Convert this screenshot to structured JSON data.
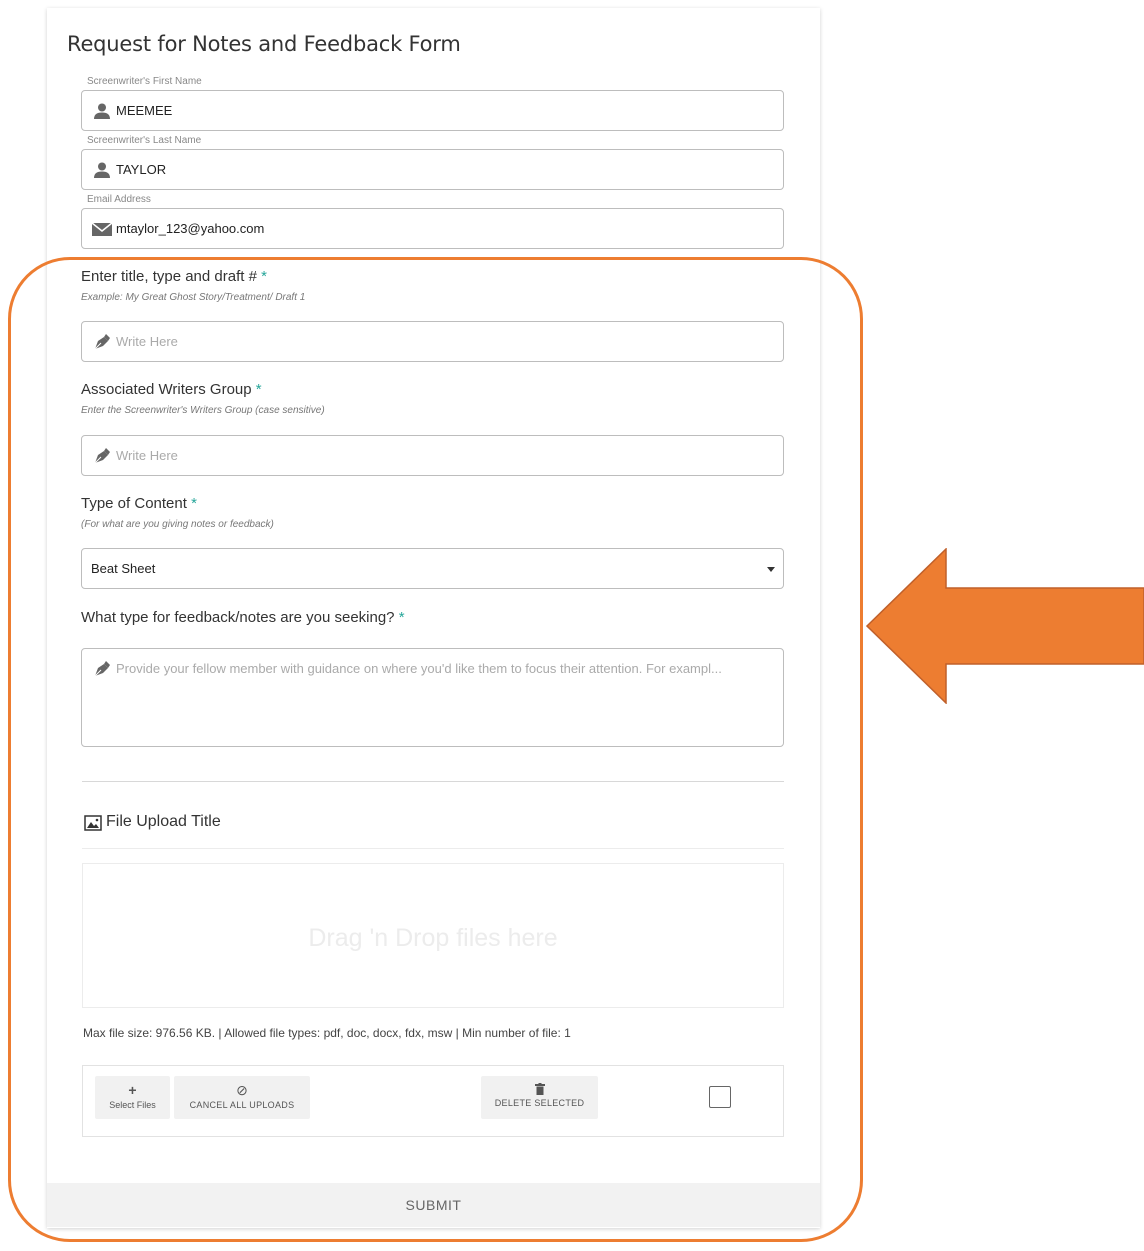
{
  "form": {
    "title": "Request for Notes and Feedback Form",
    "first_name": {
      "label": "Screenwriter's First Name",
      "value": "MEEMEE",
      "icon": "user-icon"
    },
    "last_name": {
      "label": "Screenwriter's Last Name",
      "value": "TAYLOR",
      "icon": "user-icon"
    },
    "email": {
      "label": "Email Address",
      "value": "mtaylor_123@yahoo.com",
      "icon": "envelope-icon"
    },
    "title_draft": {
      "label": "Enter title, type and draft #",
      "required": "*",
      "hint": "Example: My Great Ghost Story/Treatment/ Draft 1",
      "placeholder": "Write Here",
      "icon": "pen-icon"
    },
    "writers_group": {
      "label": "Associated Writers Group",
      "required": "*",
      "hint": "Enter the Screenwriter's Writers Group (case sensitive)",
      "placeholder": "Write Here",
      "icon": "pen-icon"
    },
    "content_type": {
      "label": "Type of Content",
      "required": "*",
      "hint": "(For what are you giving notes or feedback)",
      "selected": "Beat Sheet"
    },
    "feedback": {
      "label": "What type for feedback/notes are you seeking?",
      "required": "*",
      "placeholder": "Provide your fellow member with guidance on where you'd like them to focus their attention. For exampl...",
      "icon": "pen-icon"
    },
    "upload": {
      "title": "File Upload Title",
      "icon": "image-icon",
      "drop_text": "Drag 'n Drop files here",
      "info": "Max file size: 976.56 KB. | Allowed file types: pdf, doc, docx, fdx, msw | Min number of file: 1",
      "select_files": "Select Files",
      "cancel_all": "CANCEL ALL UPLOADS",
      "delete_selected": "DELETE SELECTED"
    },
    "submit_label": "SUBMIT"
  },
  "annotation": {
    "color": "#ed7d31"
  }
}
